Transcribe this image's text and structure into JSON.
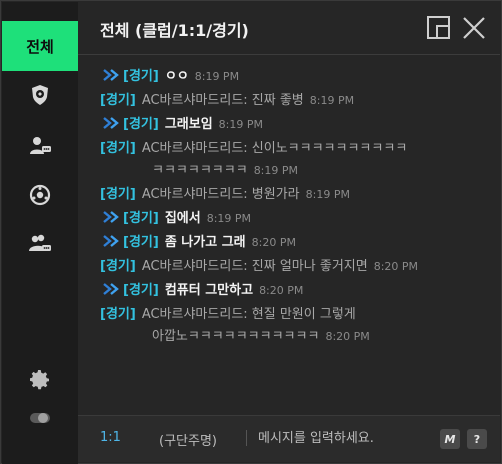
{
  "window": {
    "title": "전체 (클럽/1:1/경기)",
    "accent_color": "#1ee07a",
    "tag_color": "#33c2e0"
  },
  "sidebar": {
    "all_label": "전체",
    "icons": [
      "club-shield-icon",
      "friend-chat-icon",
      "ball-icon",
      "group-chat-icon",
      "settings-gear-icon",
      "toggle-icon"
    ]
  },
  "messages": [
    {
      "mine": true,
      "tag": "[경기]",
      "text": "ㅇㅇ",
      "time": "8:19 PM"
    },
    {
      "mine": false,
      "tag": "[경기]",
      "sender": "AC바르샤마드리드",
      "text": " : 진짜 좋병",
      "time": "8:19 PM"
    },
    {
      "mine": true,
      "tag": "[경기]",
      "text": "그래보임",
      "time": "8:19 PM"
    },
    {
      "mine": false,
      "tag": "[경기]",
      "sender": "AC바르샤마드리드",
      "text": " : 신이노ㅋㅋㅋㅋㅋㅋㅋㅋㅋㅋ",
      "cont": "ㅋㅋㅋㅋㅋㅋㅋㅋ",
      "time": "8:19 PM"
    },
    {
      "mine": false,
      "tag": "[경기]",
      "sender": "AC바르샤마드리드",
      "text": " : 병원가라",
      "time": "8:19 PM"
    },
    {
      "mine": true,
      "tag": "[경기]",
      "text": "집에서",
      "time": "8:19 PM"
    },
    {
      "mine": true,
      "tag": "[경기]",
      "text": "좀 나가고 그래",
      "time": "8:20 PM"
    },
    {
      "mine": false,
      "tag": "[경기]",
      "sender": "AC바르샤마드리드",
      "text": " : 진짜 얼마나 좋거지면",
      "time": "8:20 PM"
    },
    {
      "mine": true,
      "tag": "[경기]",
      "text": "컴퓨터 그만하고",
      "time": "8:20 PM"
    },
    {
      "mine": false,
      "tag": "[경기]",
      "sender": "AC바르샤마드리드",
      "text": " : 현질 만원이 그렇게",
      "cont": "아깝노ㅋㅋㅋㅋㅋㅋㅋㅋㅋㅋㅋ",
      "time": "8:20 PM"
    }
  ],
  "input_bar": {
    "mode_label": "1:1",
    "target_label": "(구단주명)",
    "placeholder": "메시지를 입력하세요.",
    "macro_key": "M",
    "help_key": "?"
  }
}
